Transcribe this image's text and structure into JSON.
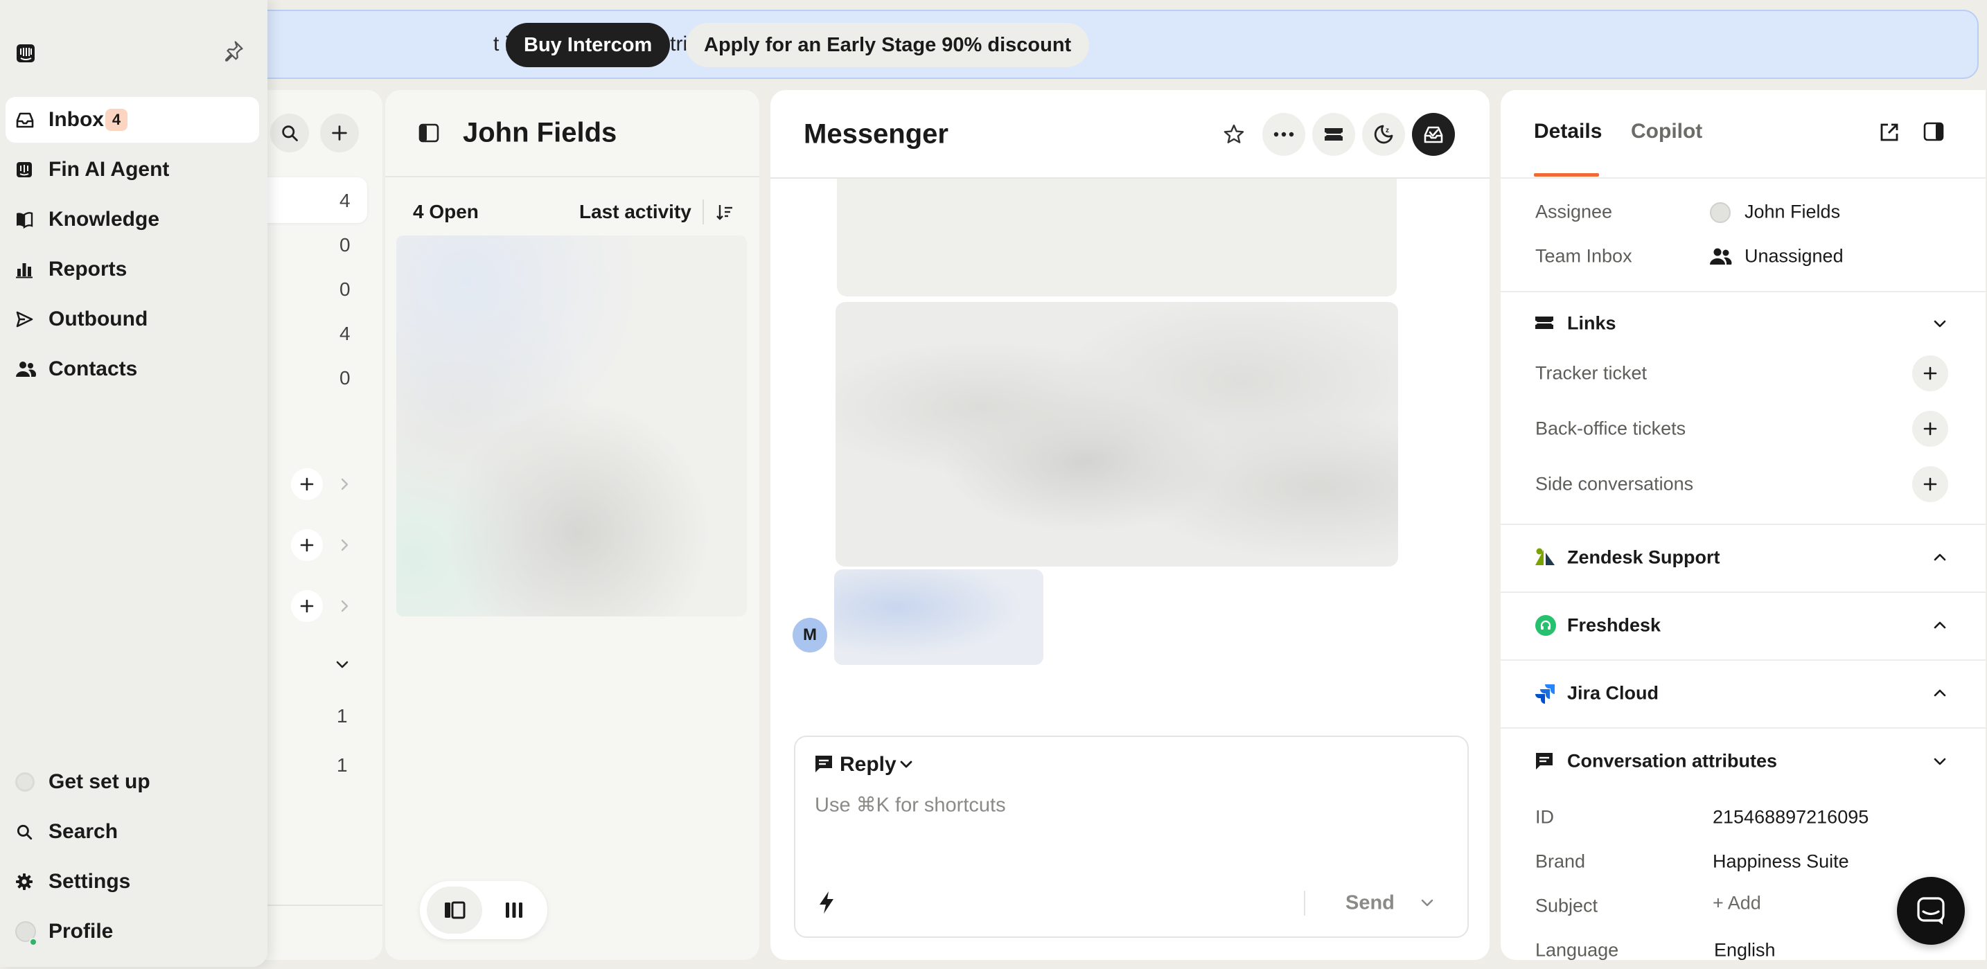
{
  "banner": {
    "text": "t in your Advanced trial",
    "buy_label": "Buy Intercom",
    "discount_label": "Apply for an Early Stage 90% discount"
  },
  "nav": {
    "items": [
      {
        "label": "Inbox",
        "badge": "4"
      },
      {
        "label": "Fin AI Agent"
      },
      {
        "label": "Knowledge"
      },
      {
        "label": "Reports"
      },
      {
        "label": "Outbound"
      },
      {
        "label": "Contacts"
      }
    ],
    "bottom_items": [
      {
        "label": "Get set up"
      },
      {
        "label": "Search"
      },
      {
        "label": "Settings"
      },
      {
        "label": "Profile"
      }
    ]
  },
  "inbox_list": {
    "counts": [
      "4",
      "0",
      "0",
      "4",
      "0"
    ],
    "lower_counts": [
      "1",
      "1"
    ]
  },
  "conversation_list": {
    "title": "John Fields",
    "open_count": "4 Open",
    "sort_label": "Last activity"
  },
  "messenger": {
    "title": "Messenger",
    "avatar_initial": "M",
    "reply_label": "Reply",
    "reply_placeholder": "Use ⌘K for shortcuts",
    "send_label": "Send"
  },
  "details": {
    "tabs": [
      "Details",
      "Copilot"
    ],
    "assignee_label": "Assignee",
    "assignee_value": "John Fields",
    "team_label": "Team Inbox",
    "team_value": "Unassigned",
    "links_title": "Links",
    "links": [
      "Tracker ticket",
      "Back-office tickets",
      "Side conversations"
    ],
    "integrations": [
      "Zendesk Support",
      "Freshdesk",
      "Jira Cloud"
    ],
    "attributes_title": "Conversation attributes",
    "attributes": [
      {
        "label": "ID",
        "value": "215468897216095"
      },
      {
        "label": "Brand",
        "value": "Happiness Suite"
      },
      {
        "label": "Subject",
        "value": "+ Add"
      },
      {
        "label": "Language",
        "value": "English"
      }
    ]
  },
  "colors": {
    "accent": "#f06a35",
    "banner_bg": "#dbe7fb",
    "freshdesk": "#25c16f",
    "jira": "#2684ff",
    "zendesk": "#78a300"
  }
}
